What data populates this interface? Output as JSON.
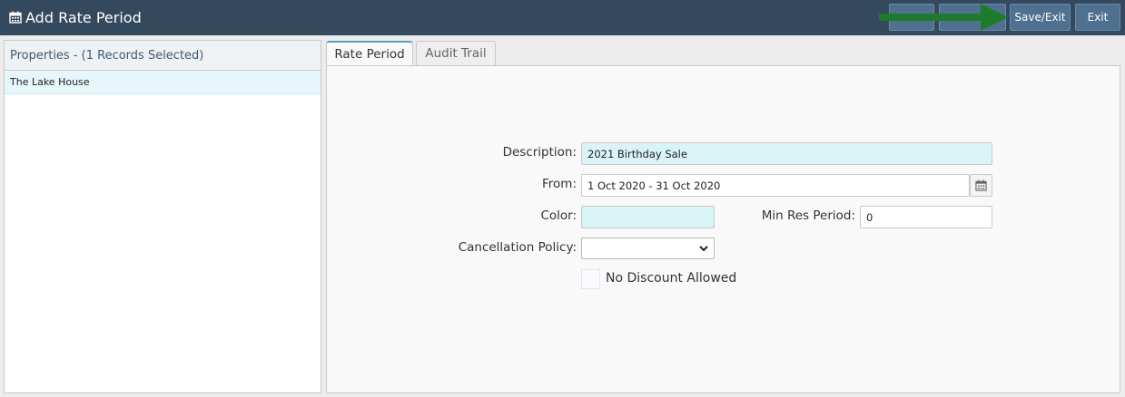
{
  "window": {
    "title": "Add Rate Period",
    "title_icon": "calendar-icon"
  },
  "toolbar": {
    "save_exit_label": "Save/Exit",
    "exit_label": "Exit",
    "accent_color": "#4f718f",
    "arrow_color": "#1e7a2c"
  },
  "properties_panel": {
    "header": "Properties - (1 Records Selected)",
    "items": [
      {
        "label": "The Lake House",
        "selected": true
      }
    ]
  },
  "tabs": [
    {
      "label": "Rate Period",
      "active": true
    },
    {
      "label": "Audit Trail",
      "active": false
    }
  ],
  "form": {
    "description_label": "Description:",
    "description_value": "2021 Birthday Sale",
    "from_label": "From:",
    "from_value": "1 Oct 2020 - 31 Oct 2020",
    "color_label": "Color:",
    "color_value": "",
    "min_res_label": "Min Res Period:",
    "min_res_value": "0",
    "cancellation_label": "Cancellation Policy:",
    "cancellation_value": "",
    "no_discount_label": "No Discount Allowed",
    "no_discount_checked": false
  }
}
